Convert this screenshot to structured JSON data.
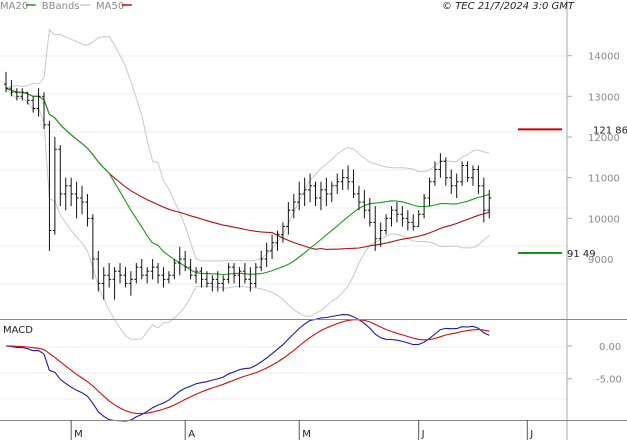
{
  "chart_data": {
    "type": "line",
    "legend": [
      {
        "label": "MA20",
        "color": "#1a9a1a"
      },
      {
        "label": "BBands",
        "color": "#c8c8c8"
      },
      {
        "label": "MA50",
        "color": "#b01010"
      }
    ],
    "credit": "© TEC 21/7/2024 3:0 GMT",
    "price_axis": {
      "min": 75,
      "max": 150,
      "ticks": [
        9000,
        10000,
        11000,
        12000,
        13000,
        14000
      ]
    },
    "months": [
      {
        "label": "M",
        "i": 12
      },
      {
        "label": "A",
        "i": 33
      },
      {
        "label": "M",
        "i": 54
      },
      {
        "label": "J",
        "i": 76
      },
      {
        "label": "J",
        "i": 96
      }
    ],
    "levels": [
      {
        "label": "121 86",
        "value": 121.86,
        "color": "#cc0000"
      },
      {
        "label": "91 49",
        "value": 91.49,
        "color": "#119911"
      }
    ],
    "ohlc": [
      [
        133,
        136,
        131,
        132
      ],
      [
        132,
        134,
        130,
        131
      ],
      [
        131,
        132,
        129,
        130
      ],
      [
        130,
        132,
        129,
        131
      ],
      [
        131,
        131,
        128,
        129
      ],
      [
        129,
        130,
        126,
        127
      ],
      [
        127,
        132,
        125,
        130
      ],
      [
        130,
        131,
        122,
        123
      ],
      [
        123,
        124,
        92,
        97
      ],
      [
        97,
        120,
        96,
        117
      ],
      [
        117,
        118,
        103,
        106
      ],
      [
        106,
        110,
        102,
        108
      ],
      [
        108,
        110,
        103,
        106
      ],
      [
        106,
        109,
        100,
        105
      ],
      [
        105,
        108,
        101,
        104
      ],
      [
        104,
        106,
        98,
        100
      ],
      [
        100,
        101,
        85,
        90
      ],
      [
        90,
        92,
        82,
        84
      ],
      [
        84,
        88,
        80,
        86
      ],
      [
        86,
        89,
        83,
        85
      ],
      [
        85,
        88,
        80,
        87
      ],
      [
        87,
        89,
        84,
        86
      ],
      [
        86,
        88,
        83,
        84
      ],
      [
        84,
        87,
        81,
        85
      ],
      [
        85,
        89,
        84,
        88
      ],
      [
        88,
        90,
        85,
        86
      ],
      [
        86,
        88,
        84,
        87
      ],
      [
        87,
        90,
        85,
        88
      ],
      [
        88,
        89,
        84,
        86
      ],
      [
        86,
        88,
        83,
        85
      ],
      [
        85,
        87,
        84,
        86
      ],
      [
        86,
        90,
        85,
        89
      ],
      [
        89,
        93,
        86,
        90
      ],
      [
        90,
        92,
        87,
        88
      ],
      [
        88,
        90,
        85,
        86
      ],
      [
        86,
        88,
        84,
        87
      ],
      [
        87,
        88,
        83,
        85
      ],
      [
        85,
        87,
        83,
        84
      ],
      [
        84,
        86,
        82,
        85
      ],
      [
        85,
        87,
        82,
        84
      ],
      [
        84,
        86,
        82,
        85
      ],
      [
        85,
        89,
        84,
        88
      ],
      [
        88,
        89,
        84,
        86
      ],
      [
        86,
        88,
        83,
        87
      ],
      [
        87,
        89,
        84,
        85
      ],
      [
        85,
        88,
        82,
        84
      ],
      [
        84,
        89,
        83,
        88
      ],
      [
        88,
        92,
        87,
        90
      ],
      [
        90,
        94,
        88,
        92
      ],
      [
        92,
        96,
        90,
        94
      ],
      [
        94,
        97,
        92,
        96
      ],
      [
        96,
        99,
        94,
        98
      ],
      [
        98,
        104,
        96,
        102
      ],
      [
        102,
        106,
        100,
        104
      ],
      [
        104,
        109,
        102,
        106
      ],
      [
        106,
        110,
        103,
        107
      ],
      [
        107,
        111,
        104,
        108
      ],
      [
        108,
        109,
        103,
        105
      ],
      [
        105,
        109,
        102,
        107
      ],
      [
        107,
        110,
        103,
        106
      ],
      [
        106,
        109,
        104,
        108
      ],
      [
        108,
        111,
        106,
        109
      ],
      [
        109,
        112,
        107,
        110
      ],
      [
        110,
        113,
        107,
        109
      ],
      [
        109,
        112,
        105,
        106
      ],
      [
        106,
        108,
        102,
        104
      ],
      [
        104,
        107,
        100,
        102
      ],
      [
        102,
        105,
        98,
        99
      ],
      [
        99,
        103,
        92,
        95
      ],
      [
        95,
        99,
        93,
        97
      ],
      [
        97,
        101,
        96,
        100
      ],
      [
        100,
        103,
        98,
        102
      ],
      [
        102,
        104,
        99,
        101
      ],
      [
        101,
        103,
        98,
        100
      ],
      [
        100,
        102,
        97,
        99
      ],
      [
        99,
        101,
        97,
        98
      ],
      [
        98,
        102,
        98,
        101
      ],
      [
        101,
        106,
        100,
        105
      ],
      [
        105,
        110,
        103,
        109
      ],
      [
        109,
        114,
        108,
        112
      ],
      [
        112,
        116,
        110,
        114
      ],
      [
        114,
        115,
        108,
        110
      ],
      [
        110,
        112,
        106,
        108
      ],
      [
        108,
        111,
        105,
        109
      ],
      [
        109,
        114,
        108,
        113
      ],
      [
        113,
        114,
        109,
        110
      ],
      [
        110,
        113,
        108,
        112
      ],
      [
        112,
        113,
        106,
        108
      ],
      [
        108,
        110,
        99,
        102
      ],
      [
        102,
        107,
        100,
        105
      ]
    ]
  }
}
